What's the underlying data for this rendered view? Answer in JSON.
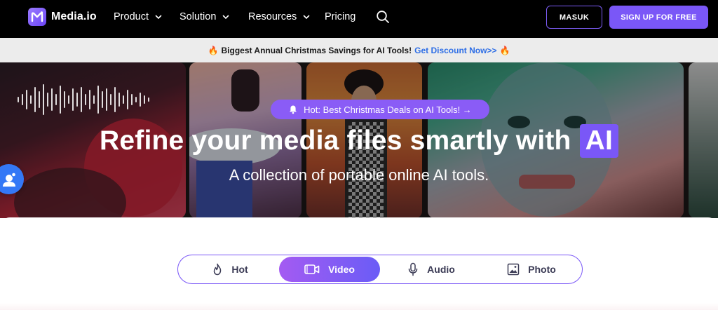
{
  "brand": {
    "name": "Media.io",
    "accent": "#7a57f7"
  },
  "nav": {
    "items": [
      {
        "label": "Product",
        "has_dropdown": true
      },
      {
        "label": "Solution",
        "has_dropdown": true
      },
      {
        "label": "Resources",
        "has_dropdown": true
      },
      {
        "label": "Pricing",
        "has_dropdown": false
      }
    ],
    "search_icon": "search-icon",
    "login_label": "MASUK",
    "signup_label": "SIGN UP FOR FREE"
  },
  "promo": {
    "icon": "fire-icon",
    "text": "Biggest Annual Christmas Savings for AI Tools!",
    "link_label": "Get Discount Now>>"
  },
  "hero": {
    "pill_label": "Hot: Best Christmas Deals on AI Tools! →",
    "pill_icon": "bell-icon",
    "headline": "Refine your media files smartly with",
    "headline_highlight": "AI",
    "subline": "A collection of portable online AI tools."
  },
  "support": {
    "icon": "chat-support-icon"
  },
  "tabs": [
    {
      "label": "Hot",
      "icon": "flame-icon",
      "active": false
    },
    {
      "label": "Video",
      "icon": "video-icon",
      "active": true
    },
    {
      "label": "Audio",
      "icon": "microphone-icon",
      "active": false
    },
    {
      "label": "Photo",
      "icon": "image-icon",
      "active": false
    }
  ]
}
